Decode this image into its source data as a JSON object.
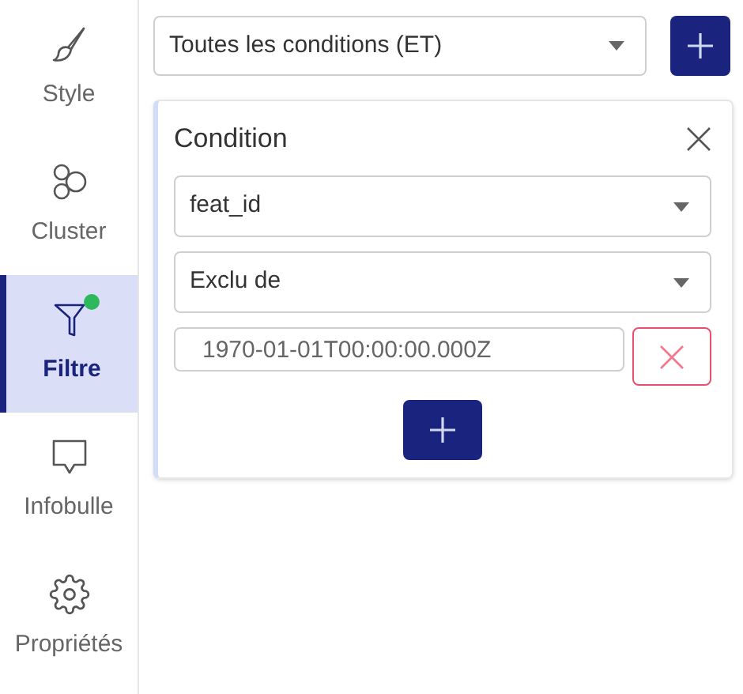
{
  "sidebar": {
    "items": [
      {
        "kind": "brush",
        "label": "Style",
        "selected": false,
        "indicator": false
      },
      {
        "kind": "circles",
        "label": "Cluster",
        "selected": false,
        "indicator": false
      },
      {
        "kind": "funnel",
        "label": "Filtre",
        "selected": true,
        "indicator": true
      },
      {
        "kind": "bubble",
        "label": "Infobulle",
        "selected": false,
        "indicator": false
      },
      {
        "kind": "gear",
        "label": "Propriétés",
        "selected": false,
        "indicator": false
      }
    ]
  },
  "match_select": {
    "value": "Toutes les conditions (ET)"
  },
  "condition": {
    "title": "Condition",
    "field_select": {
      "value": "feat_id"
    },
    "operator_select": {
      "value": "Exclu de"
    },
    "values": [
      "1970-01-01T00:00:00.000Z"
    ]
  }
}
